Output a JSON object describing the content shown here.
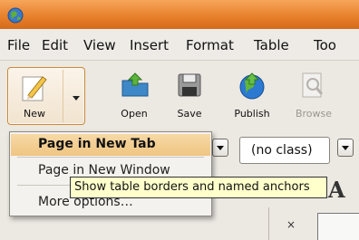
{
  "menu": {
    "file": "File",
    "edit": "Edit",
    "view": "View",
    "insert": "Insert",
    "format": "Format",
    "table": "Table",
    "tools": "Too"
  },
  "toolbar": {
    "new_label": "New",
    "open_label": "Open",
    "save_label": "Save",
    "publish_label": "Publish",
    "browse_label": "Browse"
  },
  "editbar": {
    "class_select": "(no class)"
  },
  "new_menu": {
    "items": [
      {
        "label": "Page in New Tab"
      },
      {
        "label": "Page in New Window"
      },
      {
        "label": "More options…"
      }
    ]
  },
  "tooltip": {
    "text": "Show table borders and named anchors"
  },
  "format_icon": "A",
  "table_cell": "×",
  "colors": {
    "titlebar": "#e67e2a",
    "highlight": "#efc582",
    "tooltip_bg": "#ffffcc"
  }
}
